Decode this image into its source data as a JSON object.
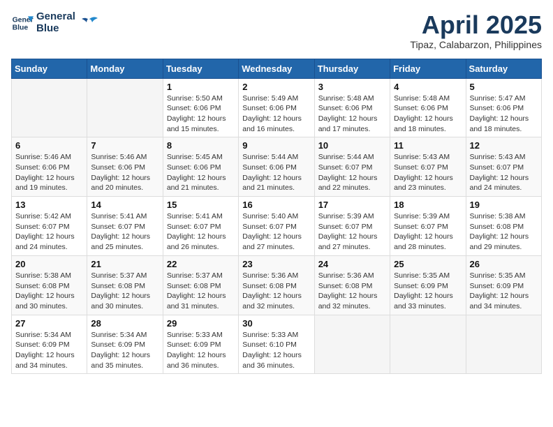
{
  "logo": {
    "line1": "General",
    "line2": "Blue"
  },
  "title": "April 2025",
  "location": "Tipaz, Calabarzon, Philippines",
  "days_of_week": [
    "Sunday",
    "Monday",
    "Tuesday",
    "Wednesday",
    "Thursday",
    "Friday",
    "Saturday"
  ],
  "weeks": [
    [
      {
        "day": "",
        "info": ""
      },
      {
        "day": "",
        "info": ""
      },
      {
        "day": "1",
        "info": "Sunrise: 5:50 AM\nSunset: 6:06 PM\nDaylight: 12 hours\nand 15 minutes."
      },
      {
        "day": "2",
        "info": "Sunrise: 5:49 AM\nSunset: 6:06 PM\nDaylight: 12 hours\nand 16 minutes."
      },
      {
        "day": "3",
        "info": "Sunrise: 5:48 AM\nSunset: 6:06 PM\nDaylight: 12 hours\nand 17 minutes."
      },
      {
        "day": "4",
        "info": "Sunrise: 5:48 AM\nSunset: 6:06 PM\nDaylight: 12 hours\nand 18 minutes."
      },
      {
        "day": "5",
        "info": "Sunrise: 5:47 AM\nSunset: 6:06 PM\nDaylight: 12 hours\nand 18 minutes."
      }
    ],
    [
      {
        "day": "6",
        "info": "Sunrise: 5:46 AM\nSunset: 6:06 PM\nDaylight: 12 hours\nand 19 minutes."
      },
      {
        "day": "7",
        "info": "Sunrise: 5:46 AM\nSunset: 6:06 PM\nDaylight: 12 hours\nand 20 minutes."
      },
      {
        "day": "8",
        "info": "Sunrise: 5:45 AM\nSunset: 6:06 PM\nDaylight: 12 hours\nand 21 minutes."
      },
      {
        "day": "9",
        "info": "Sunrise: 5:44 AM\nSunset: 6:06 PM\nDaylight: 12 hours\nand 21 minutes."
      },
      {
        "day": "10",
        "info": "Sunrise: 5:44 AM\nSunset: 6:07 PM\nDaylight: 12 hours\nand 22 minutes."
      },
      {
        "day": "11",
        "info": "Sunrise: 5:43 AM\nSunset: 6:07 PM\nDaylight: 12 hours\nand 23 minutes."
      },
      {
        "day": "12",
        "info": "Sunrise: 5:43 AM\nSunset: 6:07 PM\nDaylight: 12 hours\nand 24 minutes."
      }
    ],
    [
      {
        "day": "13",
        "info": "Sunrise: 5:42 AM\nSunset: 6:07 PM\nDaylight: 12 hours\nand 24 minutes."
      },
      {
        "day": "14",
        "info": "Sunrise: 5:41 AM\nSunset: 6:07 PM\nDaylight: 12 hours\nand 25 minutes."
      },
      {
        "day": "15",
        "info": "Sunrise: 5:41 AM\nSunset: 6:07 PM\nDaylight: 12 hours\nand 26 minutes."
      },
      {
        "day": "16",
        "info": "Sunrise: 5:40 AM\nSunset: 6:07 PM\nDaylight: 12 hours\nand 27 minutes."
      },
      {
        "day": "17",
        "info": "Sunrise: 5:39 AM\nSunset: 6:07 PM\nDaylight: 12 hours\nand 27 minutes."
      },
      {
        "day": "18",
        "info": "Sunrise: 5:39 AM\nSunset: 6:07 PM\nDaylight: 12 hours\nand 28 minutes."
      },
      {
        "day": "19",
        "info": "Sunrise: 5:38 AM\nSunset: 6:08 PM\nDaylight: 12 hours\nand 29 minutes."
      }
    ],
    [
      {
        "day": "20",
        "info": "Sunrise: 5:38 AM\nSunset: 6:08 PM\nDaylight: 12 hours\nand 30 minutes."
      },
      {
        "day": "21",
        "info": "Sunrise: 5:37 AM\nSunset: 6:08 PM\nDaylight: 12 hours\nand 30 minutes."
      },
      {
        "day": "22",
        "info": "Sunrise: 5:37 AM\nSunset: 6:08 PM\nDaylight: 12 hours\nand 31 minutes."
      },
      {
        "day": "23",
        "info": "Sunrise: 5:36 AM\nSunset: 6:08 PM\nDaylight: 12 hours\nand 32 minutes."
      },
      {
        "day": "24",
        "info": "Sunrise: 5:36 AM\nSunset: 6:08 PM\nDaylight: 12 hours\nand 32 minutes."
      },
      {
        "day": "25",
        "info": "Sunrise: 5:35 AM\nSunset: 6:09 PM\nDaylight: 12 hours\nand 33 minutes."
      },
      {
        "day": "26",
        "info": "Sunrise: 5:35 AM\nSunset: 6:09 PM\nDaylight: 12 hours\nand 34 minutes."
      }
    ],
    [
      {
        "day": "27",
        "info": "Sunrise: 5:34 AM\nSunset: 6:09 PM\nDaylight: 12 hours\nand 34 minutes."
      },
      {
        "day": "28",
        "info": "Sunrise: 5:34 AM\nSunset: 6:09 PM\nDaylight: 12 hours\nand 35 minutes."
      },
      {
        "day": "29",
        "info": "Sunrise: 5:33 AM\nSunset: 6:09 PM\nDaylight: 12 hours\nand 36 minutes."
      },
      {
        "day": "30",
        "info": "Sunrise: 5:33 AM\nSunset: 6:10 PM\nDaylight: 12 hours\nand 36 minutes."
      },
      {
        "day": "",
        "info": ""
      },
      {
        "day": "",
        "info": ""
      },
      {
        "day": "",
        "info": ""
      }
    ]
  ]
}
